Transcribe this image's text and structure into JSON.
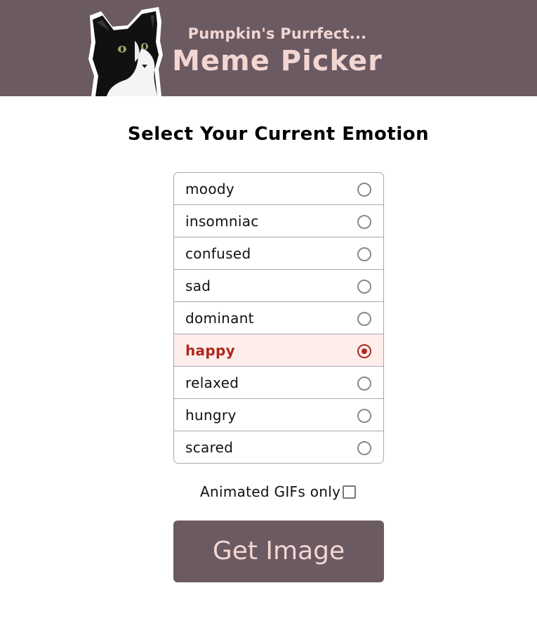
{
  "header": {
    "subtitle": "Pumpkin's Purrfect...",
    "title": "Meme Picker",
    "background_color": "#6b5a62",
    "text_color": "#f3d6d2",
    "logo_icon": "tuxedo-cat-icon"
  },
  "emotion_picker": {
    "heading": "Select Your Current Emotion",
    "options": [
      {
        "label": "moody",
        "selected": false
      },
      {
        "label": "insomniac",
        "selected": false
      },
      {
        "label": "confused",
        "selected": false
      },
      {
        "label": "sad",
        "selected": false
      },
      {
        "label": "dominant",
        "selected": false
      },
      {
        "label": "happy",
        "selected": true
      },
      {
        "label": "relaxed",
        "selected": false
      },
      {
        "label": "hungry",
        "selected": false
      },
      {
        "label": "scared",
        "selected": false
      }
    ],
    "selected_color": "#b0281d",
    "selected_background": "#fdeeec"
  },
  "gif_filter": {
    "label": "Animated GIFs only",
    "checked": false
  },
  "get_image_button": {
    "label": "Get Image"
  }
}
